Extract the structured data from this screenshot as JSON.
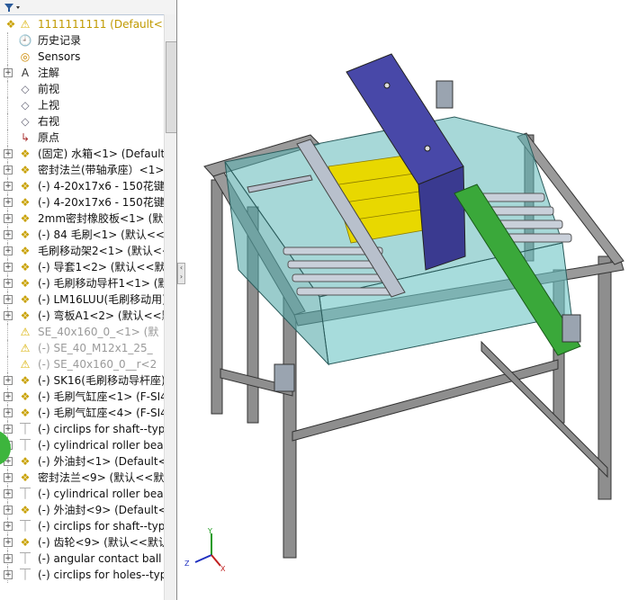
{
  "toolbar": {
    "filter_icon": "filter-icon"
  },
  "tree": {
    "root": "1111111111  (Default<D",
    "items": [
      {
        "label": "历史记录",
        "icon": "history-icon",
        "expand": ""
      },
      {
        "label": "Sensors",
        "icon": "sensor-icon",
        "expand": ""
      },
      {
        "label": "注解",
        "icon": "annotation-icon",
        "expand": "+"
      },
      {
        "label": "前视",
        "icon": "plane-icon",
        "expand": ""
      },
      {
        "label": "上视",
        "icon": "plane-icon",
        "expand": ""
      },
      {
        "label": "右视",
        "icon": "plane-icon",
        "expand": ""
      },
      {
        "label": "原点",
        "icon": "origin-icon",
        "expand": ""
      },
      {
        "label": "(固定) 水箱<1> (Default<",
        "icon": "part-icon",
        "expand": "+"
      },
      {
        "label": "密封法兰(带轴承座）<1> ",
        "icon": "part-icon",
        "expand": "+"
      },
      {
        "label": "(-) 4-20x17x6 - 150花键轴",
        "icon": "part-icon",
        "expand": "+"
      },
      {
        "label": "(-) 4-20x17x6 - 150花键",
        "icon": "part-icon",
        "expand": "+"
      },
      {
        "label": "2mm密封橡胶板<1> (默认",
        "icon": "part-icon",
        "expand": "+"
      },
      {
        "label": "(-) 84 毛刷<1> (默认<<默",
        "icon": "part-icon",
        "expand": "+"
      },
      {
        "label": "毛刷移动架2<1> (默认<<默",
        "icon": "part-icon",
        "expand": "+"
      },
      {
        "label": "(-) 导套1<2> (默认<<默认",
        "icon": "part-icon",
        "expand": "+"
      },
      {
        "label": "(-) 毛刷移动导杆1<1> (默认",
        "icon": "part-icon",
        "expand": "+"
      },
      {
        "label": "(-) LM16LUU(毛刷移动用)",
        "icon": "part-icon",
        "expand": "+"
      },
      {
        "label": "(-) 弯板A1<2> (默认<<默",
        "icon": "part-icon",
        "expand": "+"
      },
      {
        "label": "SE_40x160_0_<1> (默",
        "icon": "warning-icon",
        "expand": "",
        "suppressed": true
      },
      {
        "label": "(-) SE_40_M12x1_25_",
        "icon": "warning-icon",
        "expand": "",
        "suppressed": true
      },
      {
        "label": "(-) SE_40x160_0__r<2",
        "icon": "warning-icon",
        "expand": "",
        "suppressed": true
      },
      {
        "label": "(-) SK16(毛刷移动导杆座)",
        "icon": "part-icon",
        "expand": "+"
      },
      {
        "label": "(-) 毛刷气缸座<1> (F-SI4",
        "icon": "part-icon",
        "expand": "+"
      },
      {
        "label": "(-) 毛刷气缸座<4> (F-SI4",
        "icon": "part-icon",
        "expand": "+"
      },
      {
        "label": "(-) circlips for shaft--typ",
        "icon": "bolt-icon",
        "expand": "+"
      },
      {
        "label": "(-) cylindrical roller bear",
        "icon": "bolt-icon",
        "expand": "+"
      },
      {
        "label": "(-) 外油封<1> (Default<",
        "icon": "part-icon",
        "expand": "+"
      },
      {
        "label": "密封法兰<9> (默认<<默认",
        "icon": "part-icon",
        "expand": "+"
      },
      {
        "label": "(-) cylindrical roller bear",
        "icon": "bolt-icon",
        "expand": "+"
      },
      {
        "label": "(-) 外油封<9> (Default<",
        "icon": "part-icon",
        "expand": "+"
      },
      {
        "label": "(-) circlips for shaft--typ",
        "icon": "bolt-icon",
        "expand": "+"
      },
      {
        "label": "(-) 齿轮<9> (默认<<默认",
        "icon": "part-icon",
        "expand": "+"
      },
      {
        "label": "(-) angular contact ball b",
        "icon": "bolt-icon",
        "expand": "+"
      },
      {
        "label": "(-) circlips for holes--typ",
        "icon": "bolt-icon",
        "expand": "+"
      }
    ]
  },
  "triad": {
    "y": "Y",
    "z": "Z",
    "x": "X"
  },
  "colors": {
    "frame": "#8e8e8e",
    "glass": "#5fb8b8",
    "purple": "#4848a8",
    "yellow": "#e8d800",
    "green": "#3aa83a",
    "steel": "#b8c0cc"
  }
}
